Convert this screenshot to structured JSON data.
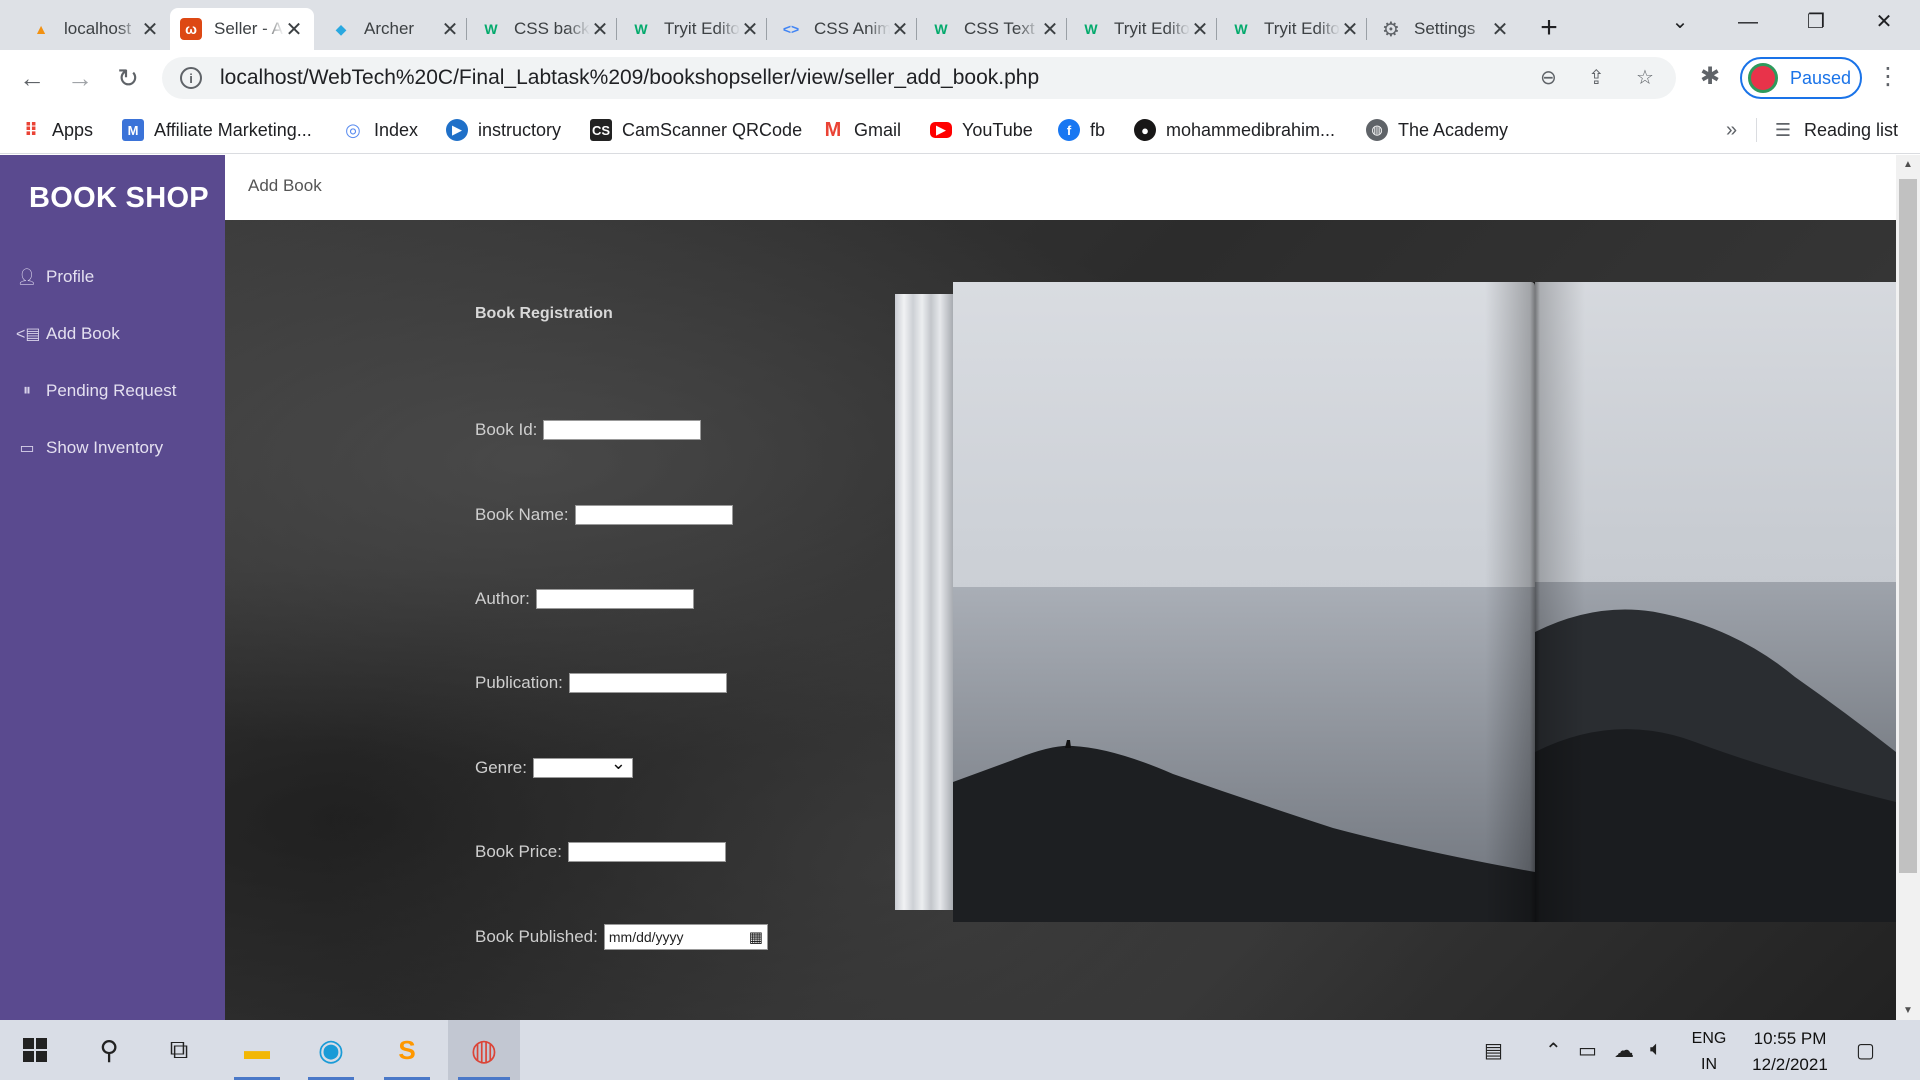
{
  "browser": {
    "tabs": [
      {
        "title": "localhost",
        "icon": "phpmyadmin-icon",
        "color": "#f29111"
      },
      {
        "title": "Seller - Add Book",
        "icon": "codeigniter-icon",
        "color": "#dd4814",
        "active": true
      },
      {
        "title": "Archer",
        "icon": "archer-icon",
        "color": "#29a8e0"
      },
      {
        "title": "CSS background",
        "icon": "w3schools-icon",
        "color": "#04aa6d"
      },
      {
        "title": "Tryit Editor",
        "icon": "w3schools-icon",
        "color": "#04aa6d"
      },
      {
        "title": "CSS Animations",
        "icon": "code-icon",
        "color": "#4285f4"
      },
      {
        "title": "CSS Text",
        "icon": "w3schools-icon",
        "color": "#04aa6d"
      },
      {
        "title": "Tryit Editor",
        "icon": "w3schools-icon",
        "color": "#04aa6d"
      },
      {
        "title": "Tryit Editor",
        "icon": "w3schools-icon",
        "color": "#04aa6d"
      },
      {
        "title": "Settings",
        "icon": "gear-icon",
        "color": "#5f6368"
      }
    ],
    "url": "localhost/WebTech%20C/Final_Labtask%209/bookshopseller/view/seller_add_book.php",
    "profile_label": "Paused",
    "bookmarks": [
      {
        "label": "Apps",
        "icon": "apps-grid-icon",
        "color": "#ea4335"
      },
      {
        "label": "Affiliate Marketing...",
        "icon": "m-logo-icon",
        "color": "#3b73d8"
      },
      {
        "label": "Index",
        "icon": "globe-icon",
        "color": "#5b8def"
      },
      {
        "label": "instructory",
        "icon": "play-icon",
        "color": "#1f70c8"
      },
      {
        "label": "CamScanner QRCode",
        "icon": "camscanner-icon",
        "color": "#222222"
      },
      {
        "label": "Gmail",
        "icon": "gmail-icon",
        "color": "#ea4335"
      },
      {
        "label": "YouTube",
        "icon": "youtube-icon",
        "color": "#ff0000"
      },
      {
        "label": "fb",
        "icon": "facebook-icon",
        "color": "#1877f2"
      },
      {
        "label": "mohammedibrahim...",
        "icon": "github-icon",
        "color": "#181717"
      },
      {
        "label": "The Academy",
        "icon": "globe-icon",
        "color": "#5f6368"
      }
    ],
    "more_bookmarks": "»",
    "reading_list": "Reading list"
  },
  "app": {
    "brand": "BOOK SHOP",
    "nav": [
      {
        "label": "Profile",
        "icon": "user-icon"
      },
      {
        "label": "Add Book",
        "icon": "add-book-icon"
      },
      {
        "label": "Pending Request",
        "icon": "pause-circle-icon"
      },
      {
        "label": "Show Inventory",
        "icon": "inventory-icon"
      }
    ],
    "page_header": "Add Book",
    "form": {
      "title": "Book Registration",
      "fields": [
        {
          "label": "Book Id:",
          "type": "text",
          "value": ""
        },
        {
          "label": "Book Name:",
          "type": "text",
          "value": ""
        },
        {
          "label": "Author:",
          "type": "text",
          "value": ""
        },
        {
          "label": "Publication:",
          "type": "text",
          "value": ""
        },
        {
          "label": "Genre:",
          "type": "select",
          "value": ""
        },
        {
          "label": "Book Price:",
          "type": "text",
          "value": ""
        },
        {
          "label": "Book Published:",
          "type": "date",
          "placeholder": "mm/dd/yyyy"
        }
      ]
    }
  },
  "taskbar": {
    "language": "ENG",
    "region": "IN",
    "time": "10:55 PM",
    "date": "12/2/2021"
  },
  "colors": {
    "sidebar": "#5a4a8f",
    "accent": "#1a73e8"
  }
}
